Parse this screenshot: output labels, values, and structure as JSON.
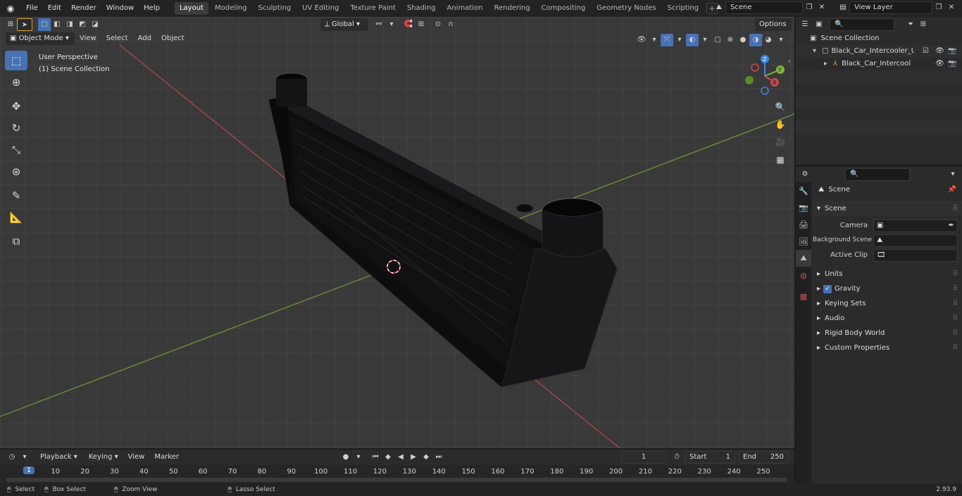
{
  "topbar": {
    "menus": [
      "File",
      "Edit",
      "Render",
      "Window",
      "Help"
    ],
    "workspaces": [
      "Layout",
      "Modeling",
      "Sculpting",
      "UV Editing",
      "Texture Paint",
      "Shading",
      "Animation",
      "Rendering",
      "Compositing",
      "Geometry Nodes",
      "Scripting"
    ],
    "active_workspace": "Layout",
    "scene_name": "Scene",
    "view_layer": "View Layer"
  },
  "viewport": {
    "mode": "Object Mode",
    "menus": [
      "View",
      "Select",
      "Add",
      "Object"
    ],
    "orientation": "Global",
    "options_label": "Options",
    "perspective_label": "User Perspective",
    "collection_label": "(1) Scene Collection",
    "tools": [
      "select-box",
      "cursor",
      "move",
      "rotate",
      "scale",
      "transform",
      "annotate",
      "measure",
      "add-cube"
    ],
    "gizmo": {
      "z": "Z",
      "y": "Y",
      "x": "X"
    }
  },
  "outliner": {
    "search_placeholder": "",
    "root": "Scene Collection",
    "collection": "Black_Car_Intercooler_Up_Sid",
    "object": "Black_Car_Intercooler_Up"
  },
  "properties": {
    "context": "Scene",
    "panel_title": "Scene",
    "camera_label": "Camera",
    "camera_value": "",
    "background_scene_label": "Background Scene",
    "active_clip_label": "Active Clip",
    "sections": [
      "Units",
      "Gravity",
      "Keying Sets",
      "Audio",
      "Rigid Body World",
      "Custom Properties"
    ],
    "gravity_checked": true
  },
  "timeline": {
    "menus": [
      "Playback",
      "Keying",
      "View",
      "Marker"
    ],
    "current_frame": "1",
    "start_label": "Start",
    "start_value": "1",
    "end_label": "End",
    "end_value": "250",
    "ruler_ticks": [
      "1",
      "10",
      "20",
      "30",
      "40",
      "50",
      "60",
      "70",
      "80",
      "90",
      "100",
      "110",
      "120",
      "130",
      "140",
      "150",
      "160",
      "170",
      "180",
      "190",
      "200",
      "210",
      "220",
      "230",
      "240",
      "250"
    ]
  },
  "statusbar": {
    "select": "Select",
    "box_select": "Box Select",
    "zoom_view": "Zoom View",
    "lasso_select": "Lasso Select",
    "version": "2.93.9"
  },
  "colors": {
    "accent": "#4772b3",
    "x_axis": "#c64a52",
    "y_axis": "#7fb338",
    "z_axis": "#3b86e0"
  }
}
